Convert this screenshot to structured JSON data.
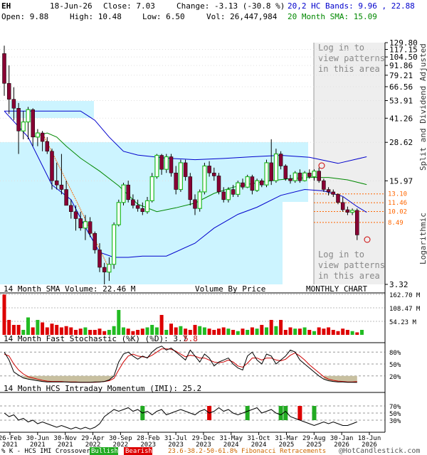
{
  "header": {
    "ticker": "EH",
    "date": "18-Jun-26",
    "close": "Close: 7.03",
    "change": "Change: -3.13 (-30.8 %)",
    "open": "Open: 9.88",
    "high": "High: 10.48",
    "low": "Low: 6.50",
    "vol": "Vol: 26,447,984",
    "bands": "20,2 HC Bands: 9.96 , 22.88",
    "sma": "20 Month SMA: 15.09",
    "bands_color": "#0000cc",
    "sma_color": "#008800"
  },
  "labels": {
    "login": [
      "Log in to",
      "view patterns",
      "in this area"
    ],
    "vol_sma": "14 Month SMA Volume: 22.46 M",
    "vbp": "Volume By Price",
    "monthly": "MONTHLY CHART",
    "stoch": "14 Month Fast Stochastic (%K) (%D): 3.7",
    "stoch_d": "5.8",
    "imi": "14 Month HCS Intraday Momentum (IMI): 25.2",
    "right_axis_1": "Split and Dividend Adjusted",
    "right_axis_2": "Logarithmic",
    "footer_left": "% K - HCS IMI Crossover,",
    "bullish": "Bullish",
    "bearish": "Bearish",
    "fib": "23.6-38.2-50-61.8% Fibonacci Retracements",
    "copyright": "@HotCandlestick.com"
  },
  "colors": {
    "up": "#22bb22",
    "down": "#880033",
    "band": "#0000cc",
    "sma": "#008800",
    "vbp": "#ccf4ff",
    "pattern": "#eeeeee",
    "fib": "#ff6600",
    "vol_up": "#22bb22",
    "vol_down": "#dd0000",
    "k_line": "#000000",
    "d_line": "#cc0000",
    "stoch_fill": "#c8c0a0",
    "bullish_bg": "#22aa22",
    "bearish_bg": "#dd0000"
  },
  "chart_data": {
    "type": "candlestick",
    "price_axis": [
      "129.80",
      "117.15",
      "104.50",
      "91.86",
      "79.21",
      "66.56",
      "53.91",
      "41.26",
      "28.62",
      "15.97",
      "3.32"
    ],
    "price_range": [
      3.32,
      129.8
    ],
    "fib_levels": [
      "13.10",
      "11.46",
      "10.02",
      "8.49"
    ],
    "x_labels": [
      [
        "26-Feb",
        "2021"
      ],
      [
        "30-Jun",
        "2021"
      ],
      [
        "30-Nov",
        "2021"
      ],
      [
        "29-Apr",
        "2022"
      ],
      [
        "30-Sep",
        "2022"
      ],
      [
        "28-Feb",
        "2023"
      ],
      [
        "31-Jul",
        "2023"
      ],
      [
        "29-Dec",
        "2023"
      ],
      [
        "31-May",
        "2024"
      ],
      [
        "31-Oct",
        "2024"
      ],
      [
        "31-Mar",
        "2025"
      ],
      [
        "29-Aug",
        "2025"
      ],
      [
        "30-Jan",
        "2026"
      ],
      [
        "18-Jun",
        "2026"
      ]
    ],
    "candles": [
      {
        "o": 110,
        "h": 124,
        "l": 58,
        "c": 70
      },
      {
        "o": 70,
        "h": 92,
        "l": 44,
        "c": 55
      },
      {
        "o": 55,
        "h": 66,
        "l": 40,
        "c": 48
      },
      {
        "o": 48,
        "h": 52,
        "l": 24,
        "c": 34
      },
      {
        "o": 34,
        "h": 46,
        "l": 30,
        "c": 39
      },
      {
        "o": 39,
        "h": 49,
        "l": 30,
        "c": 47
      },
      {
        "o": 47,
        "h": 48,
        "l": 27,
        "c": 31
      },
      {
        "o": 31,
        "h": 35,
        "l": 27,
        "c": 33
      },
      {
        "o": 33,
        "h": 34,
        "l": 25,
        "c": 29
      },
      {
        "o": 29,
        "h": 31,
        "l": 24,
        "c": 25
      },
      {
        "o": 25,
        "h": 26,
        "l": 14,
        "c": 16
      },
      {
        "o": 16,
        "h": 21,
        "l": 14,
        "c": 15
      },
      {
        "o": 15,
        "h": 24,
        "l": 13,
        "c": 14
      },
      {
        "o": 14,
        "h": 16,
        "l": 11,
        "c": 11
      },
      {
        "o": 11,
        "h": 12,
        "l": 9,
        "c": 10
      },
      {
        "o": 10,
        "h": 11,
        "l": 7.5,
        "c": 9
      },
      {
        "o": 9,
        "h": 10,
        "l": 7.5,
        "c": 7.8
      },
      {
        "o": 7.8,
        "h": 9.5,
        "l": 6.5,
        "c": 8.6
      },
      {
        "o": 8.6,
        "h": 9.2,
        "l": 6.8,
        "c": 7.2
      },
      {
        "o": 7.2,
        "h": 7.4,
        "l": 5.3,
        "c": 5.6
      },
      {
        "o": 5.6,
        "h": 6.2,
        "l": 4.0,
        "c": 4.3
      },
      {
        "o": 4.3,
        "h": 4.6,
        "l": 3.32,
        "c": 4.0
      },
      {
        "o": 4.0,
        "h": 5.0,
        "l": 3.5,
        "c": 4.5
      },
      {
        "o": 4.5,
        "h": 8.5,
        "l": 4.2,
        "c": 8.2
      },
      {
        "o": 8.2,
        "h": 12,
        "l": 8,
        "c": 11.5
      },
      {
        "o": 11.5,
        "h": 15.5,
        "l": 11,
        "c": 15
      },
      {
        "o": 15,
        "h": 16,
        "l": 11.5,
        "c": 12
      },
      {
        "o": 12,
        "h": 13,
        "l": 10.5,
        "c": 11
      },
      {
        "o": 11,
        "h": 12,
        "l": 10,
        "c": 10.5
      },
      {
        "o": 10.5,
        "h": 11.5,
        "l": 9.5,
        "c": 10
      },
      {
        "o": 10,
        "h": 12.5,
        "l": 9.7,
        "c": 11.8
      },
      {
        "o": 11.8,
        "h": 18,
        "l": 11.5,
        "c": 17
      },
      {
        "o": 17,
        "h": 24,
        "l": 16.5,
        "c": 23.5
      },
      {
        "o": 23.5,
        "h": 24,
        "l": 17.5,
        "c": 19
      },
      {
        "o": 19,
        "h": 24,
        "l": 18,
        "c": 23
      },
      {
        "o": 23,
        "h": 24,
        "l": 17,
        "c": 18
      },
      {
        "o": 18,
        "h": 20,
        "l": 13,
        "c": 14
      },
      {
        "o": 14,
        "h": 22,
        "l": 13.5,
        "c": 21
      },
      {
        "o": 21,
        "h": 22,
        "l": 16,
        "c": 17
      },
      {
        "o": 17,
        "h": 18,
        "l": 11,
        "c": 12
      },
      {
        "o": 12,
        "h": 13,
        "l": 9.5,
        "c": 10.5
      },
      {
        "o": 10.5,
        "h": 14,
        "l": 10,
        "c": 13.5
      },
      {
        "o": 13.5,
        "h": 21,
        "l": 13,
        "c": 20
      },
      {
        "o": 20,
        "h": 21.5,
        "l": 17,
        "c": 18
      },
      {
        "o": 18,
        "h": 19.5,
        "l": 16,
        "c": 17.2
      },
      {
        "o": 17.2,
        "h": 18,
        "l": 13,
        "c": 13.5
      },
      {
        "o": 13.5,
        "h": 14.5,
        "l": 11.5,
        "c": 12
      },
      {
        "o": 12,
        "h": 14.5,
        "l": 11.5,
        "c": 14
      },
      {
        "o": 14,
        "h": 15,
        "l": 12.5,
        "c": 13
      },
      {
        "o": 13,
        "h": 16,
        "l": 12.5,
        "c": 15.5
      },
      {
        "o": 15.5,
        "h": 16.5,
        "l": 14,
        "c": 14.5
      },
      {
        "o": 14.5,
        "h": 17.5,
        "l": 14.3,
        "c": 17
      },
      {
        "o": 17,
        "h": 17.5,
        "l": 13,
        "c": 13.8
      },
      {
        "o": 13.8,
        "h": 16.5,
        "l": 13.5,
        "c": 16
      },
      {
        "o": 16,
        "h": 16.5,
        "l": 14.5,
        "c": 15
      },
      {
        "o": 15,
        "h": 22,
        "l": 14.5,
        "c": 21
      },
      {
        "o": 21,
        "h": 30,
        "l": 15,
        "c": 16
      },
      {
        "o": 16,
        "h": 26,
        "l": 15.5,
        "c": 24
      },
      {
        "o": 24,
        "h": 25,
        "l": 19,
        "c": 20
      },
      {
        "o": 20,
        "h": 20.5,
        "l": 16,
        "c": 16.5
      },
      {
        "o": 16.5,
        "h": 17.5,
        "l": 15.3,
        "c": 16
      },
      {
        "o": 16,
        "h": 18.5,
        "l": 15.5,
        "c": 18
      },
      {
        "o": 18,
        "h": 19,
        "l": 15.5,
        "c": 16
      },
      {
        "o": 16,
        "h": 18.5,
        "l": 15.8,
        "c": 18
      },
      {
        "o": 18,
        "h": 19,
        "l": 16.5,
        "c": 17
      },
      {
        "o": 17,
        "h": 19,
        "l": 16,
        "c": 18.5
      },
      {
        "o": 18.5,
        "h": 19.5,
        "l": 15.5,
        "c": 16
      },
      {
        "o": 16,
        "h": 16.5,
        "l": 13.5,
        "c": 14
      },
      {
        "o": 14,
        "h": 14.5,
        "l": 12.8,
        "c": 13.5
      },
      {
        "o": 13.5,
        "h": 14,
        "l": 12.5,
        "c": 13
      },
      {
        "o": 13,
        "h": 13.2,
        "l": 11.2,
        "c": 11.5
      },
      {
        "o": 11.5,
        "h": 12.5,
        "l": 10,
        "c": 10.3
      },
      {
        "o": 10.3,
        "h": 10.8,
        "l": 9.5,
        "c": 9.9
      },
      {
        "o": 9.9,
        "h": 10.5,
        "l": 9.5,
        "c": 10.2
      },
      {
        "o": 10.2,
        "h": 10.5,
        "l": 6.5,
        "c": 7.03
      }
    ],
    "upper_band": [
      [
        0,
        46
      ],
      [
        16,
        46
      ],
      [
        19,
        40
      ],
      [
        22,
        31
      ],
      [
        25,
        25
      ],
      [
        28,
        23.6
      ],
      [
        34,
        22.5
      ],
      [
        40,
        22
      ],
      [
        46,
        22.4
      ],
      [
        52,
        23
      ],
      [
        58,
        23.5
      ],
      [
        64,
        22.8
      ],
      [
        70,
        20.8
      ],
      [
        76,
        23
      ]
    ],
    "lower_band": [
      [
        0,
        46
      ],
      [
        5,
        31
      ],
      [
        10,
        15
      ],
      [
        14,
        12
      ],
      [
        17,
        7.9
      ],
      [
        20,
        5.4
      ],
      [
        23,
        5.0
      ],
      [
        26,
        5.0
      ],
      [
        29,
        5.1
      ],
      [
        34,
        5.1
      ],
      [
        40,
        6.2
      ],
      [
        44,
        7.8
      ],
      [
        49,
        9.6
      ],
      [
        53,
        10.7
      ],
      [
        58,
        12.8
      ],
      [
        63,
        14.0
      ],
      [
        67,
        13.7
      ],
      [
        71,
        12.6
      ],
      [
        74,
        10.8
      ],
      [
        76,
        9.9
      ]
    ],
    "sma_line": [
      [
        6,
        31
      ],
      [
        9,
        33
      ],
      [
        11,
        31
      ],
      [
        13,
        27
      ],
      [
        16,
        22.5
      ],
      [
        20,
        18.5
      ],
      [
        24,
        14.8
      ],
      [
        28,
        11.2
      ],
      [
        32,
        10.0
      ],
      [
        36,
        10.6
      ],
      [
        40,
        11.4
      ],
      [
        44,
        13.2
      ],
      [
        48,
        14.5
      ],
      [
        52,
        15.3
      ],
      [
        56,
        16.0
      ],
      [
        60,
        16.5
      ],
      [
        64,
        16.8
      ],
      [
        68,
        16.8
      ],
      [
        72,
        16.2
      ],
      [
        76,
        15.09
      ]
    ],
    "volume": [
      162,
      60,
      40,
      40,
      20,
      70,
      30,
      60,
      50,
      30,
      45,
      40,
      30,
      35,
      30,
      20,
      25,
      30,
      20,
      20,
      25,
      15,
      20,
      35,
      100,
      30,
      25,
      15,
      20,
      25,
      30,
      40,
      30,
      80,
      20,
      45,
      30,
      35,
      25,
      20,
      40,
      35,
      30,
      25,
      20,
      25,
      30,
      25,
      20,
      15,
      25,
      20,
      30,
      25,
      40,
      30,
      60,
      35,
      60,
      20,
      30,
      25,
      25,
      30,
      20,
      15,
      30,
      25,
      30,
      20,
      15,
      25,
      20,
      15,
      10,
      20
    ],
    "volume_axis": [
      "162.70 M",
      "108.47 M",
      "54.23 M"
    ],
    "stoch_k": [
      80,
      60,
      30,
      22,
      15,
      12,
      10,
      8,
      6,
      5,
      5,
      5,
      5,
      5,
      4,
      4,
      4,
      4,
      4,
      5,
      5,
      6,
      10,
      20,
      55,
      75,
      80,
      70,
      62,
      70,
      65,
      80,
      90,
      95,
      85,
      90,
      80,
      70,
      60,
      85,
      70,
      55,
      75,
      65,
      45,
      55,
      60,
      65,
      50,
      40,
      35,
      70,
      80,
      60,
      50,
      75,
      70,
      50,
      60,
      70,
      85,
      80,
      60,
      50,
      40,
      30,
      20,
      12,
      8,
      6,
      5,
      5,
      4,
      4,
      3.7
    ],
    "stoch_d": [
      75,
      70,
      50,
      35,
      25,
      18,
      15,
      12,
      9,
      7,
      6,
      6,
      6,
      5,
      5,
      5,
      4,
      4,
      4,
      4,
      5,
      6,
      8,
      14,
      35,
      55,
      70,
      75,
      70,
      68,
      66,
      72,
      80,
      88,
      88,
      87,
      82,
      75,
      68,
      72,
      70,
      65,
      65,
      60,
      55,
      53,
      55,
      60,
      55,
      45,
      42,
      52,
      65,
      65,
      60,
      65,
      65,
      60,
      58,
      62,
      72,
      78,
      70,
      60,
      48,
      38,
      28,
      18,
      12,
      9,
      7,
      6,
      5,
      5,
      5.8
    ],
    "stoch_axis": [
      "80%",
      "50%",
      "20%"
    ],
    "imi": [
      50,
      40,
      45,
      30,
      35,
      25,
      30,
      20,
      25,
      20,
      15,
      10,
      15,
      10,
      5,
      10,
      5,
      10,
      5,
      10,
      20,
      40,
      50,
      60,
      55,
      60,
      65,
      55,
      60,
      50,
      55,
      45,
      55,
      60,
      45,
      50,
      55,
      60,
      55,
      50,
      45,
      55,
      60,
      50,
      55,
      65,
      55,
      60,
      50,
      45,
      50,
      55,
      60,
      65,
      50,
      55,
      60,
      50,
      45,
      55,
      40,
      35,
      30,
      25,
      20,
      15,
      20,
      25,
      20,
      25,
      20,
      15,
      15,
      20,
      25.2
    ],
    "imi_axis": [
      "70%",
      "50%",
      "30%"
    ],
    "imi_markers": [
      {
        "i": 29,
        "t": "bull"
      },
      {
        "i": 43,
        "t": "bear"
      },
      {
        "i": 51,
        "t": "bull"
      },
      {
        "i": 58,
        "t": "bull"
      },
      {
        "i": 59,
        "t": "bull"
      },
      {
        "i": 62,
        "t": "bear"
      },
      {
        "i": 65,
        "t": "bull"
      }
    ]
  }
}
